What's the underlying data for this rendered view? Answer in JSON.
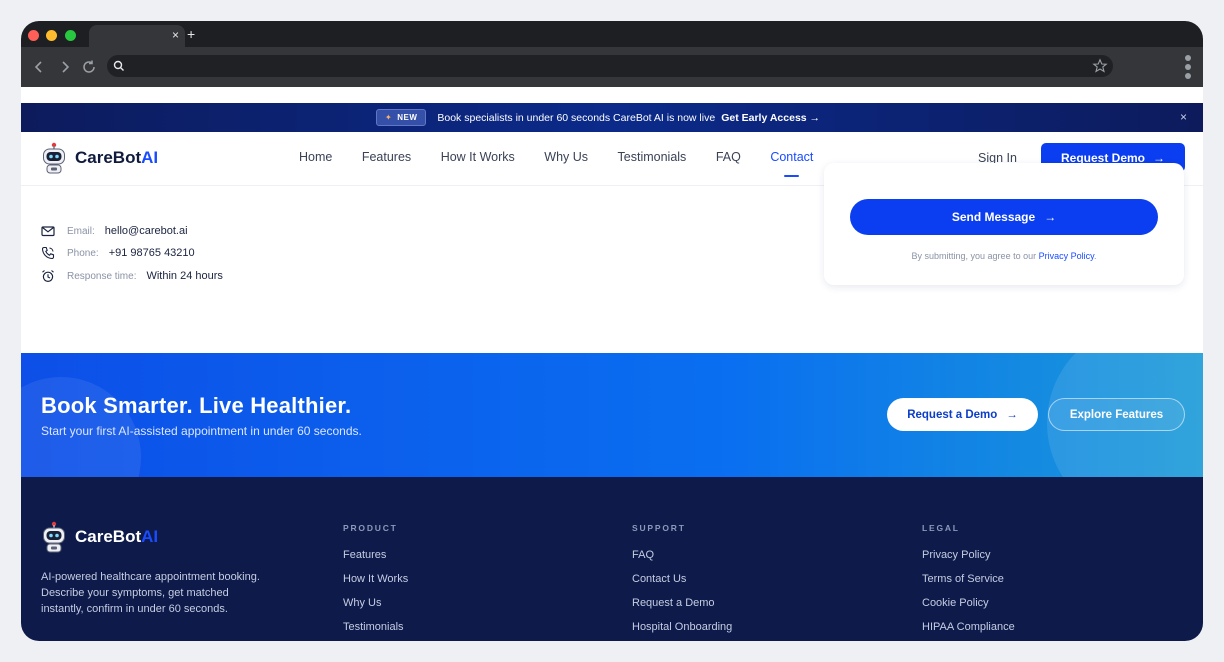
{
  "browser": {
    "tab_close": "×",
    "tab_new": "+"
  },
  "announcement": {
    "badge": "NEW",
    "text": "Book specialists in under 60 seconds CareBot AI is now live",
    "cta": "Get Early Access →",
    "close": "×"
  },
  "brand": {
    "name_main": "CareBot",
    "name_accent": "AI"
  },
  "nav": {
    "links": [
      "Home",
      "Features",
      "How It Works",
      "Why Us",
      "Testimonials",
      "FAQ",
      "Contact"
    ],
    "active": "Contact",
    "sign_in": "Sign In",
    "request_demo": "Request Demo"
  },
  "contact": {
    "email_label": "Email:",
    "email_value": "hello@carebot.ai",
    "phone_label": "Phone:",
    "phone_value": "+91 98765 43210",
    "response_label": "Response time:",
    "response_value": "Within 24 hours"
  },
  "form": {
    "send_label": "Send Message",
    "terms_prefix": "By submitting, you agree to our",
    "terms_link": "Privacy Policy",
    "terms_suffix": "."
  },
  "cta": {
    "title": "Book Smarter. Live Healthier.",
    "subtitle": "Start your first AI-assisted appointment in under 60 seconds.",
    "primary": "Request a Demo",
    "secondary": "Explore Features"
  },
  "footer": {
    "description": "AI-powered healthcare appointment booking. Describe your symptoms, get matched instantly, confirm in under 60 seconds.",
    "columns": [
      {
        "heading": "PRODUCT",
        "items": [
          "Features",
          "How It Works",
          "Why Us",
          "Testimonials"
        ]
      },
      {
        "heading": "SUPPORT",
        "items": [
          "FAQ",
          "Contact Us",
          "Request a Demo",
          "Hospital Onboarding"
        ]
      },
      {
        "heading": "LEGAL",
        "items": [
          "Privacy Policy",
          "Terms of Service",
          "Cookie Policy",
          "HIPAA Compliance"
        ]
      }
    ],
    "socials": [
      "x-icon",
      "linkedin-icon",
      "instagram-icon",
      "youtube-icon"
    ]
  },
  "colors": {
    "primary": "#0b3ef0",
    "accent_text": "#1a4cff",
    "footer_bg": "#0d1a4a",
    "announce_bg": "#0b2a8a"
  }
}
